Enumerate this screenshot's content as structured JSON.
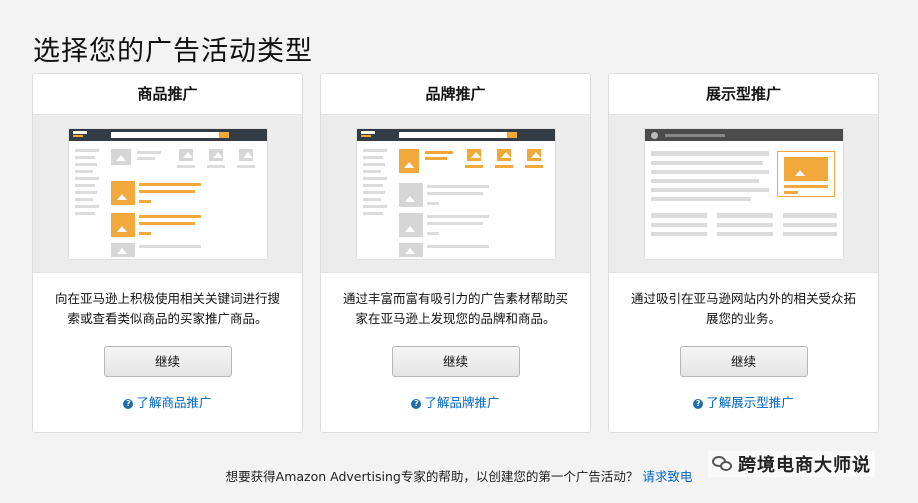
{
  "page": {
    "title": "选择您的广告活动类型"
  },
  "cards": [
    {
      "title": "商品推广",
      "description_line1": "向在亚马逊上积极使用相关关键词进行搜",
      "description_line2": "索或查看类似商品的买家推广商品。",
      "button_label": "继续",
      "learn_more": "了解商品推广"
    },
    {
      "title": "品牌推广",
      "description_line1": "通过丰富而富有吸引力的广告素材帮助买",
      "description_line2": "家在亚马逊上发现您的品牌和商品。",
      "button_label": "继续",
      "learn_more": "了解品牌推广"
    },
    {
      "title": "展示型推广",
      "description_line1": "通过吸引在亚马逊网站内外的相关受众拓",
      "description_line2": "展您的业务。",
      "button_label": "继续",
      "learn_more": "了解展示型推广"
    }
  ],
  "footer": {
    "text": "想要获得Amazon Advertising专家的帮助，以创建您的第一个广告活动？",
    "contact_link": "请求致电"
  },
  "watermark": {
    "text": "跨境电商大师说"
  },
  "colors": {
    "accent_orange": "#f2a93b",
    "link_blue": "#0066c0",
    "page_bg": "#f3f3f3"
  },
  "icons": {
    "help": "question-circle-icon",
    "wechat": "wechat-icon"
  }
}
